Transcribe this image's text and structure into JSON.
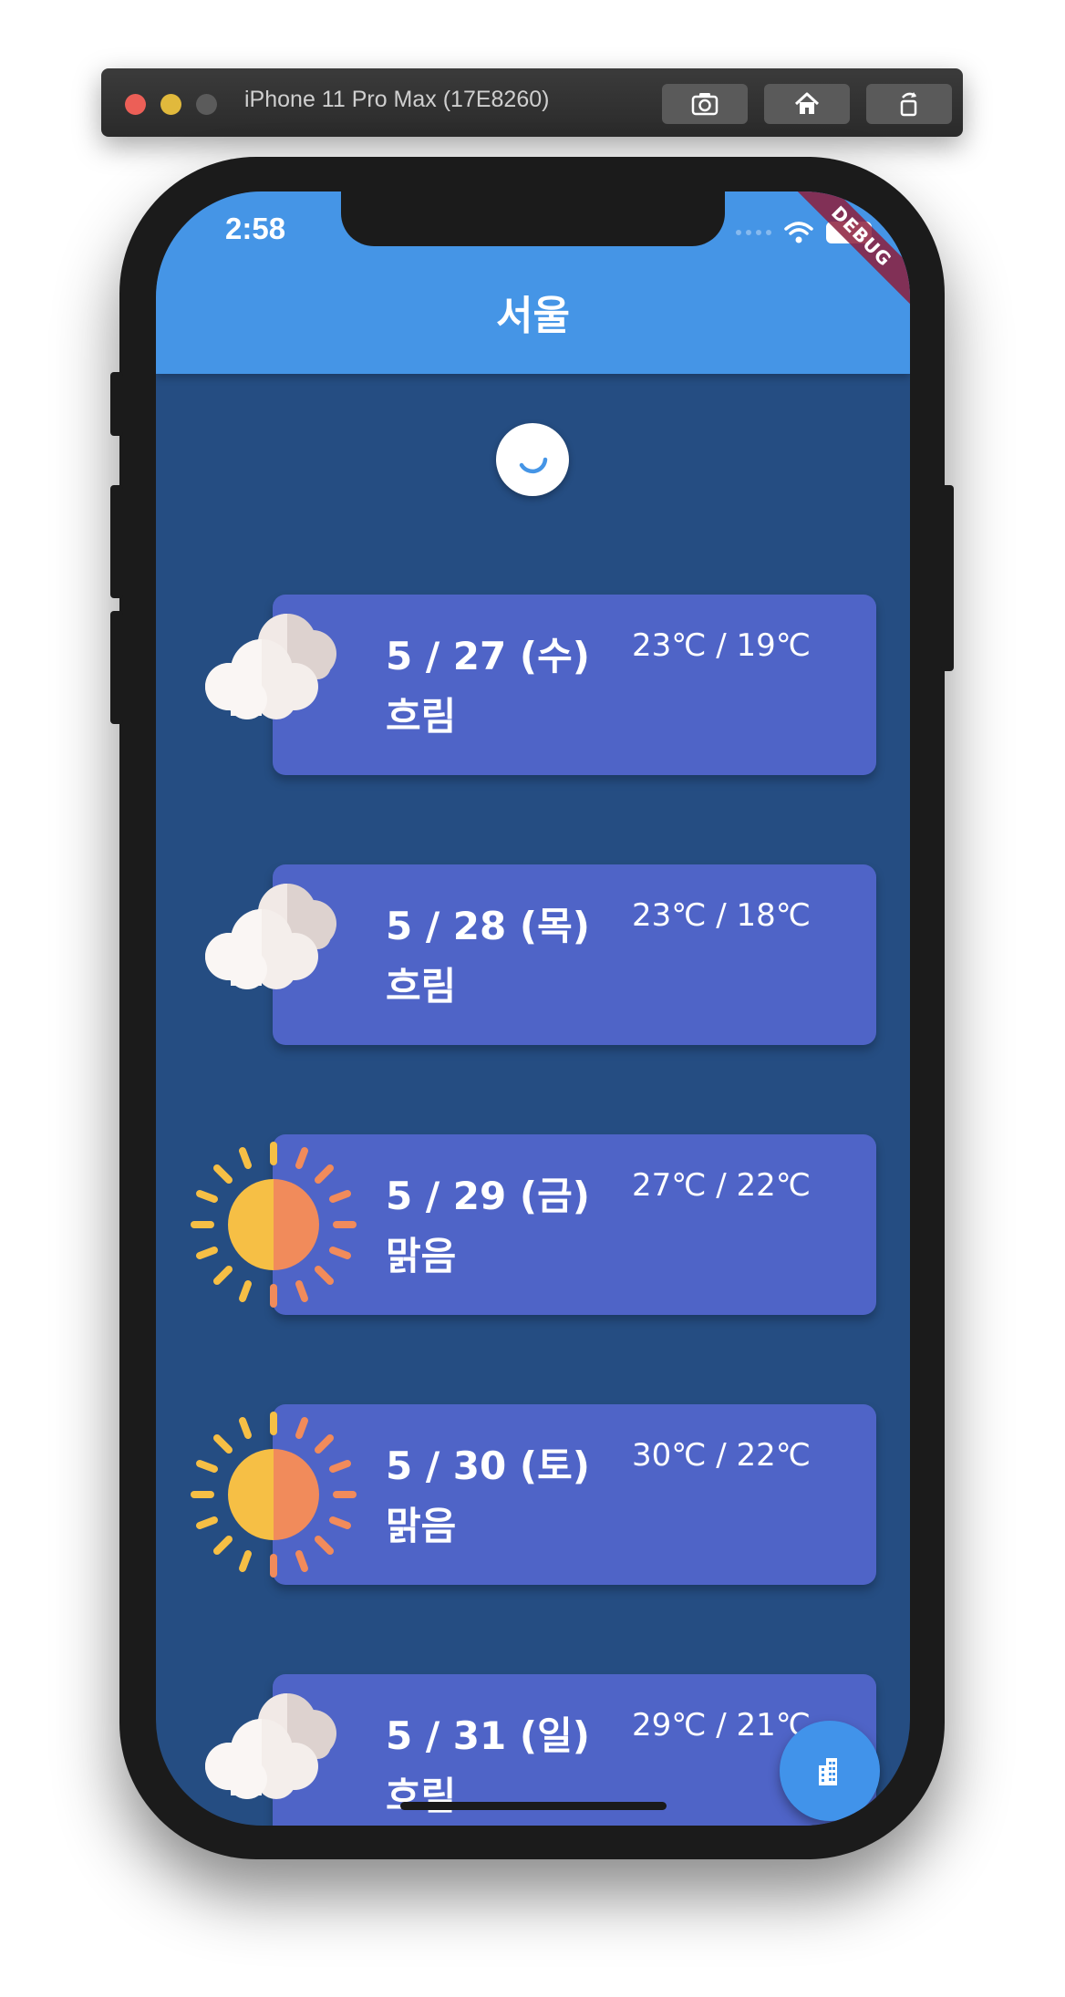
{
  "simulator": {
    "title": "iPhone 11 Pro Max (17E8260)"
  },
  "status_bar": {
    "time": "2:58",
    "debug_label": "DEBUG"
  },
  "app_bar": {
    "title": "서울"
  },
  "forecast": [
    {
      "date": "5 / 27 (수)",
      "condition": "흐림",
      "temp": "23℃ / 19℃",
      "icon": "cloud-icon"
    },
    {
      "date": "5 / 28 (목)",
      "condition": "흐림",
      "temp": "23℃ / 18℃",
      "icon": "cloud-icon"
    },
    {
      "date": "5 / 29 (금)",
      "condition": "맑음",
      "temp": "27℃ / 22℃",
      "icon": "sun-icon"
    },
    {
      "date": "5 / 30 (토)",
      "condition": "맑음",
      "temp": "30℃ / 22℃",
      "icon": "sun-icon"
    },
    {
      "date": "5 / 31 (일)",
      "condition": "흐림",
      "temp": "29℃ / 21℃",
      "icon": "cloud-icon"
    }
  ],
  "colors": {
    "app_bar": "#4595e6",
    "background": "#254d82",
    "card": "#4f64c7",
    "fab": "#4193ea"
  },
  "fab": {
    "icon": "city-icon"
  }
}
